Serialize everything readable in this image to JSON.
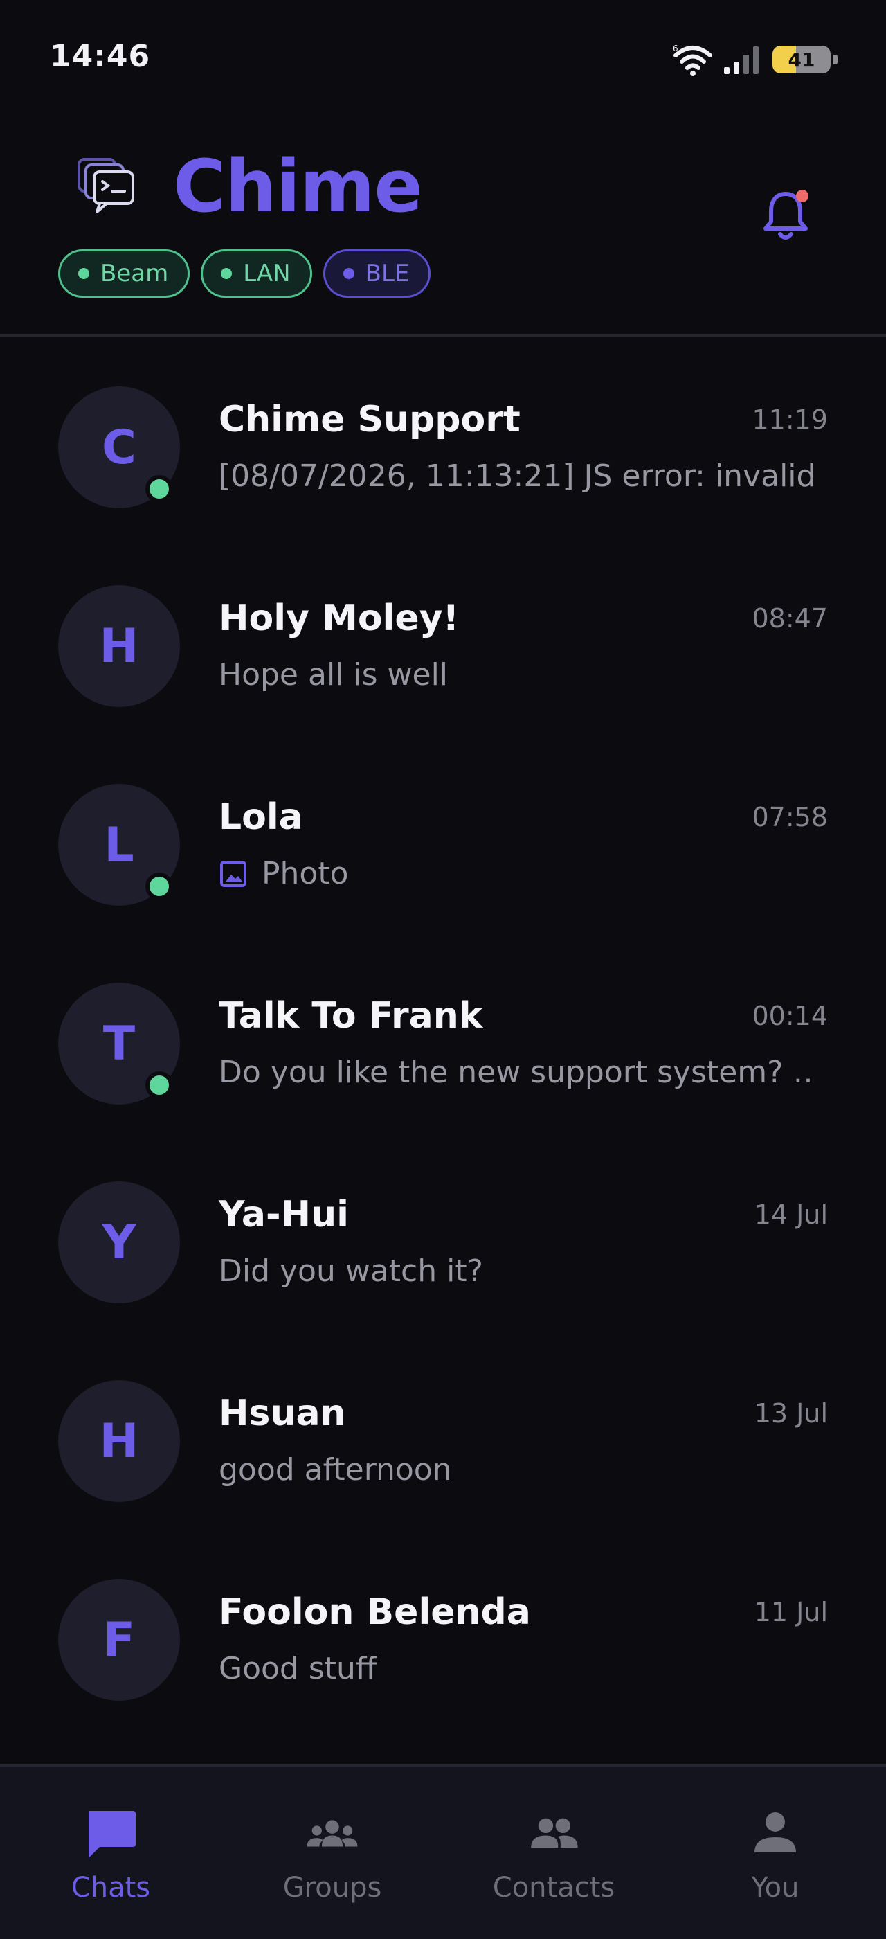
{
  "status_bar": {
    "time": "14:46",
    "battery_level": "41",
    "battery_fraction": 0.41
  },
  "header": {
    "title": "Chime",
    "chips": [
      {
        "label": "Beam",
        "style": "green"
      },
      {
        "label": "LAN",
        "style": "green"
      },
      {
        "label": "BLE",
        "style": "purple"
      }
    ],
    "notification_indicator": true
  },
  "chats": [
    {
      "initial": "C",
      "name": "Chime Support",
      "time": "11:19",
      "preview": "[08/07/2026, 11:13:21] JS error: invalid…",
      "online": true
    },
    {
      "initial": "H",
      "name": "Holy Moley!",
      "time": "08:47",
      "preview": "Hope all is well",
      "online": false
    },
    {
      "initial": "L",
      "name": "Lola",
      "time": "07:58",
      "preview": "Photo",
      "online": true,
      "has_photo_icon": true
    },
    {
      "initial": "T",
      "name": "Talk To Frank",
      "time": "00:14",
      "preview": "Do you like the new support system? …",
      "online": true
    },
    {
      "initial": "Y",
      "name": "Ya-Hui",
      "time": "14 Jul",
      "preview": "Did you watch it?",
      "online": false
    },
    {
      "initial": "H",
      "name": "Hsuan",
      "time": "13 Jul",
      "preview": "good afternoon",
      "online": false
    },
    {
      "initial": "F",
      "name": "Foolon Belenda",
      "time": "11 Jul",
      "preview": "Good stuff",
      "online": false
    }
  ],
  "nav": [
    {
      "label": "Chats",
      "icon": "chat-bubble-icon",
      "active": true
    },
    {
      "label": "Groups",
      "icon": "groups-icon",
      "active": false
    },
    {
      "label": "Contacts",
      "icon": "contacts-icon",
      "active": false
    },
    {
      "label": "You",
      "icon": "person-icon",
      "active": false
    }
  ],
  "colors": {
    "accent": "#6c5ce7",
    "online": "#5fd69b",
    "background": "#0b0b10"
  }
}
